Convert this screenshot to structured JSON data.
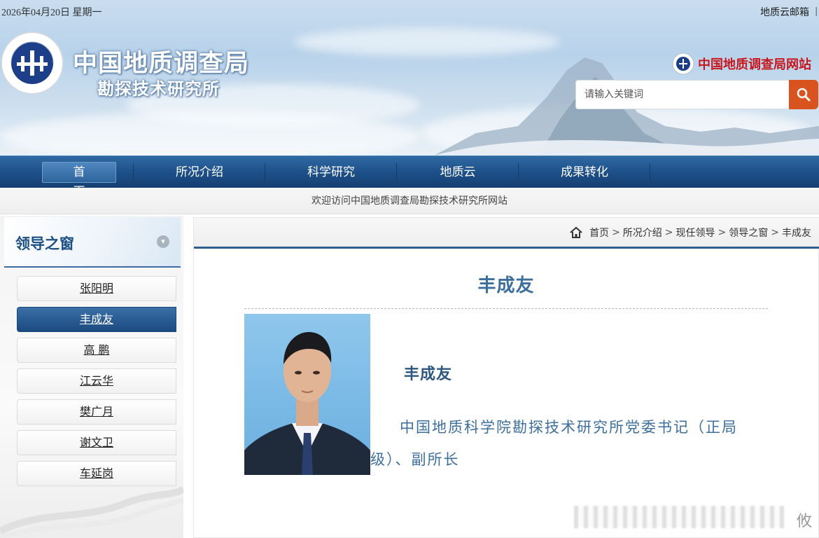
{
  "header": {
    "date": "2026年04月20日 星期一",
    "mail_link": "地质云邮箱",
    "mail_sep": "|",
    "org_title": "中国地质调查局",
    "org_subtitle": "勘探技术研究所",
    "cgs_link": "中国地质调查局网站",
    "search": {
      "placeholder": "请输入关键词",
      "icon": "search-icon",
      "button_color": "#d9531e"
    }
  },
  "nav": {
    "items": [
      {
        "label": "首页",
        "active": true
      },
      {
        "label": "所况介绍"
      },
      {
        "label": "科学研究"
      },
      {
        "label": "地质云"
      },
      {
        "label": "成果转化"
      }
    ],
    "color": "#1e5089"
  },
  "welcome_text": "欢迎访问中国地质调查局勘探技术研究所网站",
  "sidebar": {
    "title": "领导之窗",
    "items": [
      {
        "label": "张阳明"
      },
      {
        "label": "丰成友",
        "active": true
      },
      {
        "label": "高 鹏"
      },
      {
        "label": "江云华"
      },
      {
        "label": "樊广月"
      },
      {
        "label": "谢文卫"
      },
      {
        "label": "车延岗"
      }
    ]
  },
  "breadcrumb": {
    "items": [
      "首页",
      "所况介绍",
      "现任领导",
      "领导之窗",
      "丰成友"
    ],
    "separator": ">"
  },
  "article": {
    "title": "丰成友",
    "name": "丰成友",
    "description": "中国地质科学院勘探技术研究所党委书记（正局级）、副所长"
  },
  "watermark": "攸",
  "colors": {
    "accent": "#1b4f84",
    "title_blue": "#3d6f9d",
    "cgs_red": "#c8161d"
  }
}
